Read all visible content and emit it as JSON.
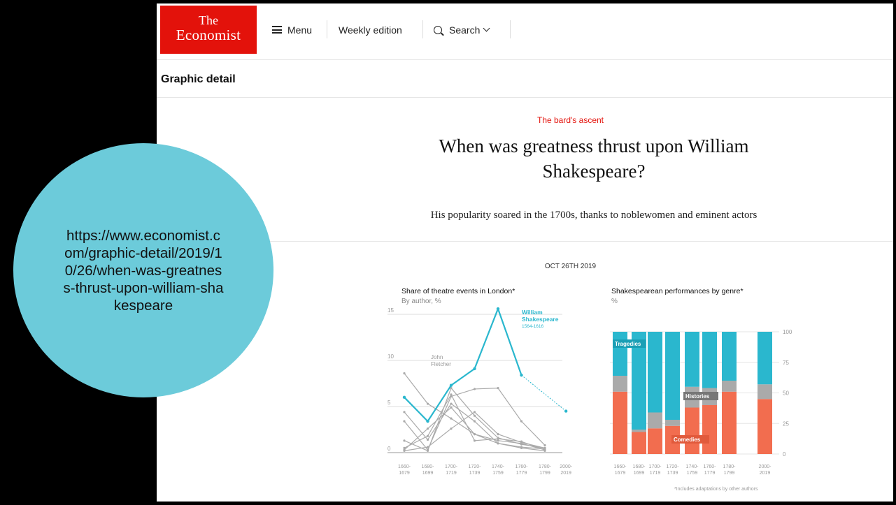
{
  "site": {
    "logo_line1": "The",
    "logo_line2": "Economist"
  },
  "nav": {
    "menu": "Menu",
    "weekly": "Weekly edition",
    "search": "Search"
  },
  "section": "Graphic detail",
  "article": {
    "kicker": "The bard's ascent",
    "headline_line1": "When was greatness thrust upon William",
    "headline_line2": "Shakespeare?",
    "dek": "His popularity soared in the 1700s, thanks to noblewomen and eminent actors",
    "date": "OCT 26TH 2019"
  },
  "colors": {
    "teal": "#2ab7ce",
    "grey": "#aaaaaa",
    "orange": "#f26d4f",
    "red": "#e3120b",
    "circle": "#6ccbda"
  },
  "overlay": {
    "url": "https://www.economist.com/graphic-detail/2019/10/26/when-was-greatness-thrust-upon-william-shakespeare"
  },
  "footnote": "*Includes adaptations by other authors",
  "chart_data": [
    {
      "type": "line",
      "title": "Share of theatre events in London*",
      "subtitle": "By author, %",
      "y_ticks": [
        "15",
        "10",
        "5",
        "0"
      ],
      "ylim": [
        0,
        15
      ],
      "categories": [
        [
          "1660-",
          "1679"
        ],
        [
          "1680-",
          "1699"
        ],
        [
          "1700-",
          "1719"
        ],
        [
          "1720-",
          "1739"
        ],
        [
          "1740-",
          "1759"
        ],
        [
          "1760-",
          "1779"
        ],
        [
          "1780-",
          "1799"
        ],
        [
          "2000-",
          "2019"
        ]
      ],
      "series": [
        {
          "name": "William Shakespeare",
          "years": "1564-1616",
          "values": [
            6,
            3.4,
            7.3,
            9.1,
            15.6,
            8.4,
            null,
            4.5
          ],
          "dashed_last": true
        },
        {
          "name": "John Fletcher",
          "values": [
            8.6,
            5.3,
            3.7,
            2.0,
            1.0,
            0.5,
            0.2,
            null
          ]
        },
        {
          "values": [
            4.4,
            1.4,
            5.3,
            3.4,
            1.0,
            0.6,
            0.4,
            null
          ]
        },
        {
          "values": [
            3.4,
            0.3,
            6.1,
            6.9,
            7.0,
            3.4,
            0.8,
            null
          ]
        },
        {
          "values": [
            1.3,
            0.2,
            7.0,
            4.0,
            1.6,
            0.9,
            0.5,
            null
          ]
        },
        {
          "values": [
            0.3,
            2.6,
            4.9,
            2.0,
            1.3,
            1.0,
            0.3,
            null
          ]
        },
        {
          "values": [
            0.2,
            0.6,
            2.6,
            4.4,
            2.0,
            1.1,
            0.5,
            null
          ]
        },
        {
          "values": [
            0.5,
            1.8,
            6.3,
            1.3,
            1.5,
            1.2,
            0.3,
            null
          ]
        }
      ],
      "labels": {
        "shakespeare_l1": "William",
        "shakespeare_l2": "Shakespeare",
        "shakespeare_years": "1564-1616",
        "fletcher_l1": "John",
        "fletcher_l2": "Fletcher"
      }
    },
    {
      "type": "bar",
      "stacked": true,
      "title": "Shakespearean performances by genre*",
      "subtitle": "%",
      "y_ticks": [
        "100",
        "75",
        "50",
        "25",
        "0"
      ],
      "ylim": [
        0,
        100
      ],
      "categories": [
        [
          "1660-",
          "1679"
        ],
        [
          "1680-",
          "1699"
        ],
        [
          "1700-",
          "1719"
        ],
        [
          "1720-",
          "1739"
        ],
        [
          "1740-",
          "1759"
        ],
        [
          "1760-",
          "1779"
        ],
        [
          "1780-",
          "1799"
        ],
        [
          "2000-",
          "2019"
        ]
      ],
      "series": [
        {
          "name": "Comedies",
          "values": [
            51,
            18,
            21,
            23,
            38,
            40,
            51,
            45
          ]
        },
        {
          "name": "Histories",
          "values": [
            13,
            2,
            13,
            5,
            17,
            14,
            9,
            12
          ]
        },
        {
          "name": "Tragedies",
          "values": [
            36,
            80,
            66,
            72,
            45,
            46,
            40,
            43
          ]
        }
      ]
    }
  ]
}
